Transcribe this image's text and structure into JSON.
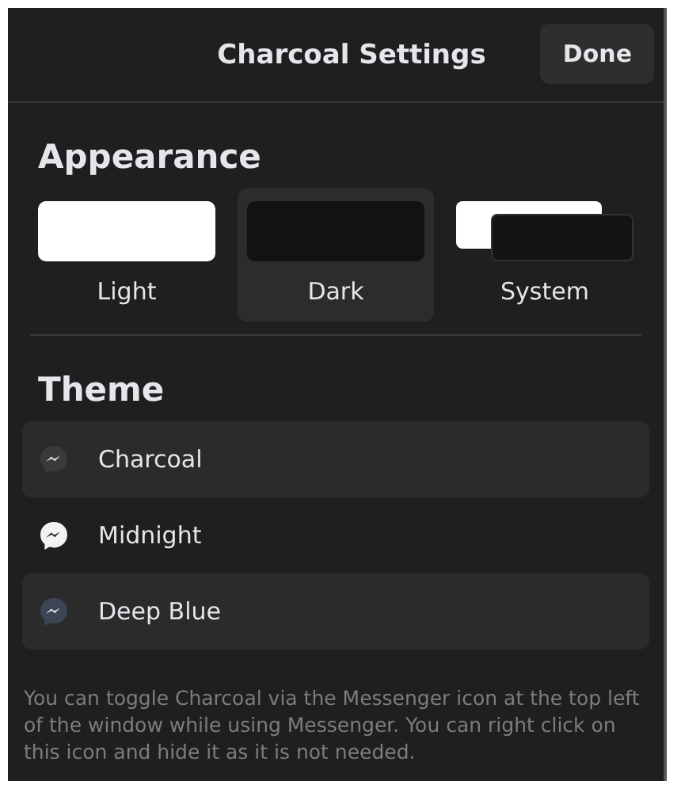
{
  "header": {
    "title": "Charcoal Settings",
    "done_button": "Done"
  },
  "appearance": {
    "heading": "Appearance",
    "options": [
      {
        "label": "Light",
        "kind": "light",
        "selected": false
      },
      {
        "label": "Dark",
        "kind": "dark",
        "selected": true
      },
      {
        "label": "System",
        "kind": "system",
        "selected": false
      }
    ]
  },
  "theme": {
    "heading": "Theme",
    "items": [
      {
        "label": "Charcoal",
        "highlighted": true,
        "color": "#3a3a3a"
      },
      {
        "label": "Midnight",
        "highlighted": false,
        "color": "#f2f2f2"
      },
      {
        "label": "Deep Blue",
        "highlighted": true,
        "color": "#3b4556"
      }
    ]
  },
  "note": "You can toggle Charcoal via the Messenger icon at the top left of the window while using Messenger. You can right click on this icon and hide it as it is not needed."
}
